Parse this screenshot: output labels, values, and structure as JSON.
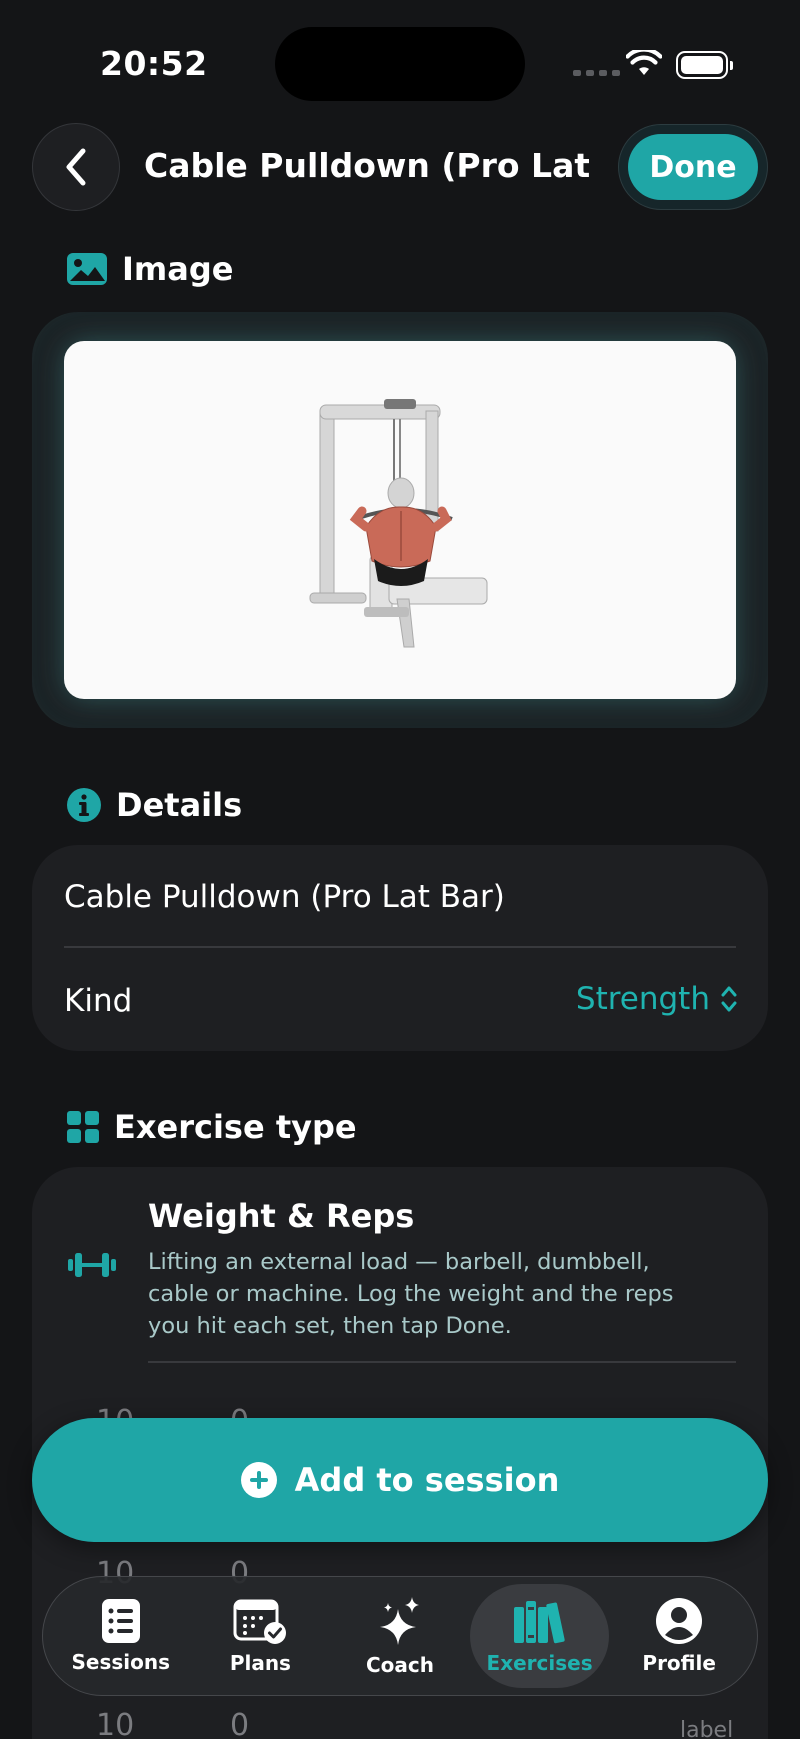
{
  "status_bar": {
    "time": "20:52"
  },
  "header": {
    "title": "Cable Pulldown (Pro Lat B...",
    "done_label": "Done"
  },
  "image_section": {
    "title": "Image"
  },
  "details_section": {
    "title": "Details",
    "name_value": "Cable Pulldown (Pro Lat Bar)",
    "kind_label": "Kind",
    "kind_value": "Strength"
  },
  "exercise_type_section": {
    "title": "Exercise type",
    "type_name": "Weight & Reps",
    "type_description": "Lifting an external load — barbell, dumbbell, cable or machine. Log the weight and the reps you hit each set, then tap Done."
  },
  "background_rows": {
    "row1": [
      "10",
      "0"
    ],
    "row2": [
      "10",
      "0"
    ],
    "row3": [
      "10",
      "0"
    ],
    "side_label": "label"
  },
  "add_button": {
    "label": "Add to session"
  },
  "tab_bar": {
    "tabs": [
      {
        "label": "Sessions",
        "icon": "list-icon"
      },
      {
        "label": "Plans",
        "icon": "calendar-check-icon"
      },
      {
        "label": "Coach",
        "icon": "sparkles-icon"
      },
      {
        "label": "Exercises",
        "icon": "library-icon",
        "active": true
      },
      {
        "label": "Profile",
        "icon": "person-icon"
      }
    ]
  },
  "colors": {
    "accent": "#1fa6a6",
    "background": "#141517",
    "card": "#1e1f22"
  }
}
